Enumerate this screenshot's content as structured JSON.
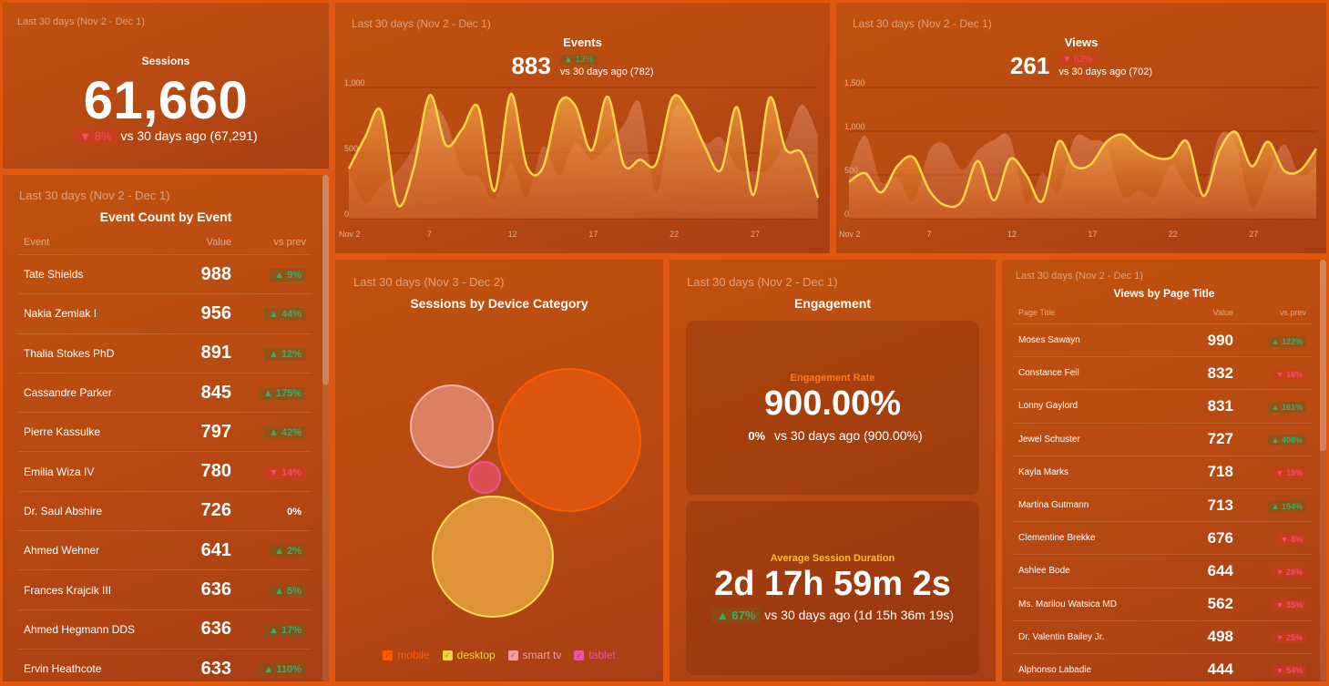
{
  "colors": {
    "background": "#e0570f",
    "line": "#ffd54a",
    "up": "#35b06a",
    "down": "#f0506a",
    "mobile": "#ff5a00",
    "desktop": "#f5d040",
    "smart_tv": "#f0a0a0",
    "tablet": "#f050a0"
  },
  "sessions": {
    "date_range": "Last 30 days (Nov 2 - Dec 1)",
    "title": "Sessions",
    "value": "61,660",
    "change": "▼ 8%",
    "change_dir": "down",
    "compare": "vs 30 days ago (67,291)"
  },
  "events": {
    "date_range": "Last 30 days (Nov 2 - Dec 1)",
    "title": "Events",
    "value": "883",
    "change": "▲ 13%",
    "change_dir": "up",
    "compare": "vs 30 days ago (782)"
  },
  "views": {
    "date_range": "Last 30 days (Nov 2 - Dec 1)",
    "title": "Views",
    "value": "261",
    "change": "▼ 63%",
    "change_dir": "down",
    "compare": "vs 30 days ago (702)"
  },
  "chart_data": [
    {
      "type": "area",
      "title": "Events",
      "x": [
        "Nov 2",
        "Nov 3",
        "Nov 4",
        "Nov 5",
        "Nov 6",
        "Nov 7",
        "Nov 8",
        "Nov 9",
        "Nov 10",
        "Nov 11",
        "Nov 12",
        "Nov 13",
        "Nov 14",
        "Nov 15",
        "Nov 16",
        "Nov 17",
        "Nov 18",
        "Nov 19",
        "Nov 20",
        "Nov 21",
        "Nov 22",
        "Nov 23",
        "Nov 24",
        "Nov 25",
        "Nov 26",
        "Nov 27",
        "Nov 28",
        "Nov 29",
        "Nov 30",
        "Dec 1"
      ],
      "xticks": [
        "Nov 2",
        "7",
        "12",
        "17",
        "22",
        "27"
      ],
      "yticks": [
        "0",
        "500",
        "1,000"
      ],
      "ylim": [
        0,
        1000
      ],
      "grid": true,
      "series": [
        {
          "name": "current",
          "values": [
            380,
            620,
            820,
            110,
            380,
            940,
            560,
            680,
            850,
            210,
            950,
            400,
            390,
            880,
            860,
            520,
            930,
            410,
            450,
            420,
            920,
            820,
            550,
            370,
            850,
            180,
            920,
            530,
            500,
            160
          ]
        },
        {
          "name": "previous",
          "values": [
            360,
            120,
            250,
            360,
            550,
            840,
            750,
            360,
            320,
            150,
            420,
            160,
            550,
            330,
            580,
            450,
            560,
            720,
            880,
            200,
            810,
            820,
            580,
            620,
            390,
            360,
            380,
            590,
            870,
            640
          ]
        }
      ]
    },
    {
      "type": "area",
      "title": "Views",
      "x": [
        "Nov 2",
        "Nov 3",
        "Nov 4",
        "Nov 5",
        "Nov 6",
        "Nov 7",
        "Nov 8",
        "Nov 9",
        "Nov 10",
        "Nov 11",
        "Nov 12",
        "Nov 13",
        "Nov 14",
        "Nov 15",
        "Nov 16",
        "Nov 17",
        "Nov 18",
        "Nov 19",
        "Nov 20",
        "Nov 21",
        "Nov 22",
        "Nov 23",
        "Nov 24",
        "Nov 25",
        "Nov 26",
        "Nov 27",
        "Nov 28",
        "Nov 29",
        "Nov 30",
        "Dec 1"
      ],
      "xticks": [
        "Nov 2",
        "7",
        "12",
        "17",
        "22",
        "27"
      ],
      "yticks": [
        "0",
        "500",
        "1,000",
        "1,500"
      ],
      "ylim": [
        0,
        1500
      ],
      "grid": true,
      "series": [
        {
          "name": "current",
          "values": [
            420,
            520,
            300,
            600,
            700,
            320,
            150,
            200,
            660,
            210,
            680,
            500,
            200,
            880,
            600,
            620,
            880,
            960,
            800,
            700,
            700,
            880,
            260,
            780,
            990,
            600,
            880,
            550,
            550,
            800
          ]
        },
        {
          "name": "previous",
          "values": [
            550,
            950,
            420,
            480,
            200,
            780,
            850,
            560,
            780,
            900,
            920,
            180,
            520,
            300,
            920,
            900,
            820,
            260,
            320,
            250,
            620,
            350,
            280,
            950,
            850,
            130,
            500,
            850,
            500,
            600
          ]
        }
      ]
    },
    {
      "type": "scatter",
      "subtype": "bubble",
      "title": "Sessions by Device Category",
      "legend": "bottom",
      "series": [
        {
          "name": "mobile",
          "relative_size": 1.0
        },
        {
          "name": "desktop",
          "relative_size": 0.72
        },
        {
          "name": "smart tv",
          "relative_size": 0.33
        },
        {
          "name": "tablet",
          "relative_size": 0.05
        }
      ]
    }
  ],
  "event_count": {
    "date_range": "Last 30 days (Nov 2 - Dec 1)",
    "title": "Event Count by Event",
    "columns": [
      "Event",
      "Value",
      "vs prev"
    ],
    "rows": [
      {
        "name": "Tate Shields",
        "value": "988",
        "change": "▲ 9%",
        "dir": "up"
      },
      {
        "name": "Nakia Zemlak I",
        "value": "956",
        "change": "▲ 44%",
        "dir": "up"
      },
      {
        "name": "Thalia Stokes PhD",
        "value": "891",
        "change": "▲ 12%",
        "dir": "up"
      },
      {
        "name": "Cassandre Parker",
        "value": "845",
        "change": "▲ 175%",
        "dir": "up"
      },
      {
        "name": "Pierre Kassulke",
        "value": "797",
        "change": "▲ 42%",
        "dir": "up"
      },
      {
        "name": "Emilia Wiza IV",
        "value": "780",
        "change": "▼ 14%",
        "dir": "down"
      },
      {
        "name": "Dr. Saul Abshire",
        "value": "726",
        "change": "0%",
        "dir": "flat"
      },
      {
        "name": "Ahmed Wehner",
        "value": "641",
        "change": "▲ 2%",
        "dir": "up"
      },
      {
        "name": "Frances Krajcik III",
        "value": "636",
        "change": "▲ 5%",
        "dir": "up"
      },
      {
        "name": "Ahmed Hegmann DDS",
        "value": "636",
        "change": "▲ 17%",
        "dir": "up"
      },
      {
        "name": "Ervin Heathcote",
        "value": "633",
        "change": "▲ 110%",
        "dir": "up"
      }
    ]
  },
  "device": {
    "date_range": "Last 30 days (Nov 3 - Dec 2)",
    "title": "Sessions by Device Category",
    "legend": [
      {
        "label": "mobile",
        "checked": true
      },
      {
        "label": "desktop",
        "checked": true
      },
      {
        "label": "smart tv",
        "checked": true
      },
      {
        "label": "tablet",
        "checked": true
      }
    ],
    "check_glyph": "✓"
  },
  "engagement": {
    "date_range": "Last 30 days (Nov 2 - Dec 1)",
    "title": "Engagement",
    "rate": {
      "label": "Engagement Rate",
      "value": "900.00%",
      "change": "0%",
      "change_dir": "flat",
      "compare": "vs 30 days ago (900.00%)"
    },
    "duration": {
      "label": "Average Session Duration",
      "value": "2d 17h 59m 2s",
      "change": "▲ 67%",
      "change_dir": "up",
      "compare": "vs 30 days ago (1d 15h 36m 19s)"
    }
  },
  "page_title": {
    "date_range": "Last 30 days (Nov 2 - Dec 1)",
    "title": "Views by Page Title",
    "columns": [
      "Page Title",
      "Value",
      "vs prev"
    ],
    "rows": [
      {
        "name": "Moses Sawayn",
        "value": "990",
        "change": "▲ 122%",
        "dir": "up"
      },
      {
        "name": "Constance Feil",
        "value": "832",
        "change": "▼ 16%",
        "dir": "down"
      },
      {
        "name": "Lonny Gaylord",
        "value": "831",
        "change": "▲ 161%",
        "dir": "up"
      },
      {
        "name": "Jewel Schuster",
        "value": "727",
        "change": "▲ 408%",
        "dir": "up"
      },
      {
        "name": "Kayla Marks",
        "value": "718",
        "change": "▼ 15%",
        "dir": "down"
      },
      {
        "name": "Martina Gutmann",
        "value": "713",
        "change": "▲ 154%",
        "dir": "up"
      },
      {
        "name": "Clementine Brekke",
        "value": "676",
        "change": "▼ 8%",
        "dir": "down"
      },
      {
        "name": "Ashlee Bode",
        "value": "644",
        "change": "▼ 28%",
        "dir": "down"
      },
      {
        "name": "Ms. Marilou Watsica MD",
        "value": "562",
        "change": "▼ 35%",
        "dir": "down"
      },
      {
        "name": "Dr. Valentin Bailey Jr.",
        "value": "498",
        "change": "▼ 25%",
        "dir": "down"
      },
      {
        "name": "Alphonso Labadie",
        "value": "444",
        "change": "▼ 54%",
        "dir": "down"
      }
    ]
  }
}
